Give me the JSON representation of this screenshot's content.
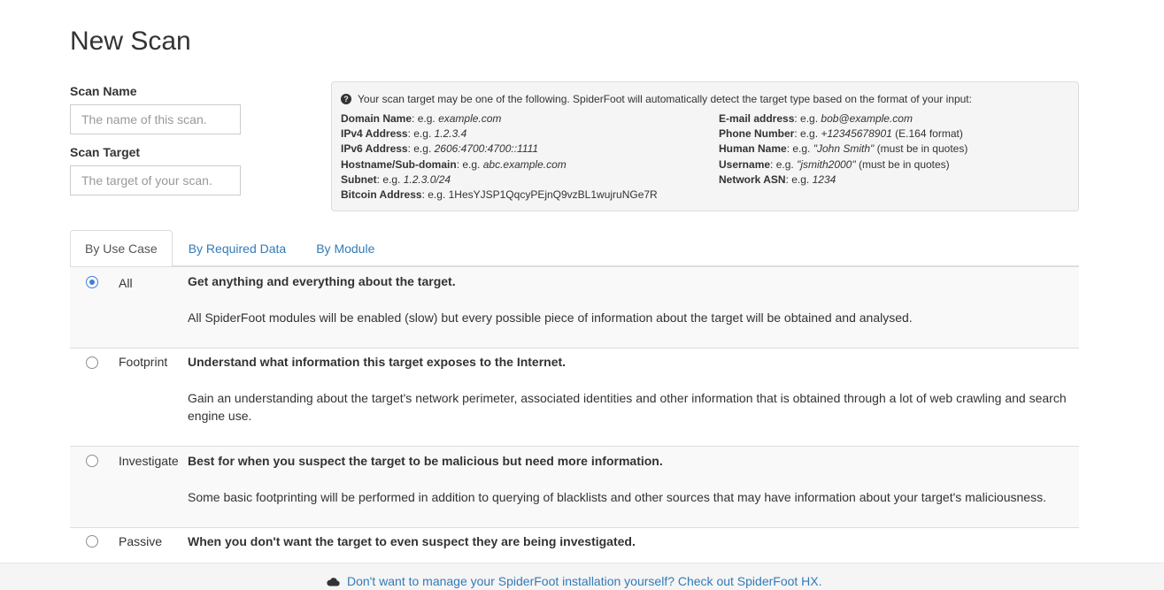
{
  "page": {
    "title": "New Scan"
  },
  "form": {
    "scan_name": {
      "label": "Scan Name",
      "placeholder": "The name of this scan."
    },
    "scan_target": {
      "label": "Scan Target",
      "placeholder": "The target of your scan."
    }
  },
  "info": {
    "intro": "Your scan target may be one of the following. SpiderFoot will automatically detect the target type based on the format of your input:",
    "left": [
      {
        "label": "Domain Name",
        "sep": ": e.g. ",
        "example": "example.com",
        "italic": true,
        "suffix": ""
      },
      {
        "label": "IPv4 Address",
        "sep": ": e.g. ",
        "example": "1.2.3.4",
        "italic": true,
        "suffix": ""
      },
      {
        "label": "IPv6 Address",
        "sep": ": e.g. ",
        "example": "2606:4700:4700::1111",
        "italic": true,
        "suffix": ""
      },
      {
        "label": "Hostname/Sub-domain",
        "sep": ": e.g. ",
        "example": "abc.example.com",
        "italic": true,
        "suffix": ""
      },
      {
        "label": "Subnet",
        "sep": ": e.g. ",
        "example": "1.2.3.0/24",
        "italic": true,
        "suffix": ""
      },
      {
        "label": "Bitcoin Address",
        "sep": ": e.g. ",
        "example": "1HesYJSP1QqcyPEjnQ9vzBL1wujruNGe7R",
        "italic": false,
        "suffix": ""
      }
    ],
    "right": [
      {
        "label": "E-mail address",
        "sep": ": e.g. ",
        "example": "bob@example.com",
        "italic": true,
        "suffix": ""
      },
      {
        "label": "Phone Number",
        "sep": ": e.g. ",
        "example": "+12345678901",
        "italic": true,
        "suffix": " (E.164 format)"
      },
      {
        "label": "Human Name",
        "sep": ": e.g. ",
        "example": "\"John Smith\"",
        "italic": true,
        "suffix": " (must be in quotes)"
      },
      {
        "label": "Username",
        "sep": ": e.g. ",
        "example": "\"jsmith2000\"",
        "italic": true,
        "suffix": " (must be in quotes)"
      },
      {
        "label": "Network ASN",
        "sep": ": e.g. ",
        "example": "1234",
        "italic": true,
        "suffix": ""
      }
    ]
  },
  "tabs": [
    {
      "label": "By Use Case",
      "active": true
    },
    {
      "label": "By Required Data",
      "active": false
    },
    {
      "label": "By Module",
      "active": false
    }
  ],
  "usecases": [
    {
      "name": "All",
      "checked": true,
      "title": "Get anything and everything about the target.",
      "desc": "All SpiderFoot modules will be enabled (slow) but every possible piece of information about the target will be obtained and analysed."
    },
    {
      "name": "Footprint",
      "checked": false,
      "title": "Understand what information this target exposes to the Internet.",
      "desc": "Gain an understanding about the target's network perimeter, associated identities and other information that is obtained through a lot of web crawling and search engine use."
    },
    {
      "name": "Investigate",
      "checked": false,
      "title": "Best for when you suspect the target to be malicious but need more information.",
      "desc": "Some basic footprinting will be performed in addition to querying of blacklists and other sources that may have information about your target's maliciousness."
    },
    {
      "name": "Passive",
      "checked": false,
      "title": "When you don't want the target to even suspect they are being investigated.",
      "desc": ""
    }
  ],
  "footer": {
    "link_text": "Don't want to manage your SpiderFoot installation yourself? Check out SpiderFoot HX.",
    "icon": "cloud-icon"
  }
}
